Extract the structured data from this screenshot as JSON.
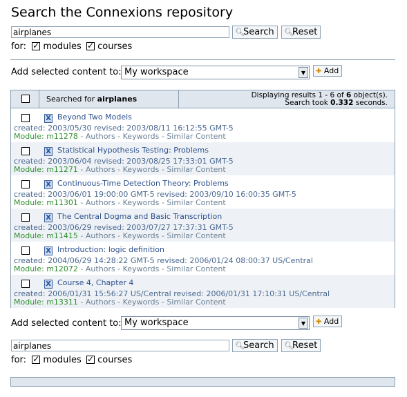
{
  "page_title": "Search the Connexions repository",
  "search_top": {
    "value": "airplanes",
    "search_label": "Search",
    "reset_label": "Reset",
    "for_label": "for:",
    "modules_label": "modules",
    "courses_label": "courses",
    "modules_checked": true,
    "courses_checked": true
  },
  "add_top": {
    "label": "Add selected content to:",
    "selected": "My workspace",
    "button_label": "Add"
  },
  "results": {
    "searched_for_prefix": "Searched for",
    "searched_term": "airplanes",
    "stats_line1_prefix": "Displaying results 1 - 6 of",
    "stats_count": "6",
    "stats_line1_suffix": "object(s).",
    "stats_line2_prefix": "Search took",
    "stats_time": "0.332",
    "stats_line2_suffix": "seconds.",
    "links": {
      "authors": "Authors",
      "keywords": "Keywords",
      "similar": "Similar Content"
    },
    "items": [
      {
        "title": "Beyond Two Models",
        "created": "created: 2003/05/30 revised: 2003/08/11 16:12:55 GMT-5",
        "module_label": "Module:",
        "module_id": "m11278"
      },
      {
        "title": "Statistical Hypothesis Testing: Problems",
        "created": "created: 2003/06/04 revised: 2003/08/25 17:33:01 GMT-5",
        "module_label": "Module:",
        "module_id": "m11271"
      },
      {
        "title": "Continuous-Time Detection Theory: Problems",
        "created": "created: 2003/06/01 19:00:00 GMT-5 revised: 2003/09/10 16:00:35 GMT-5",
        "module_label": "Module:",
        "module_id": "m11301"
      },
      {
        "title": "The Central Dogma and Basic Transcription",
        "created": "created: 2003/06/29 revised: 2003/07/27 17:37:31 GMT-5",
        "module_label": "Module:",
        "module_id": "m11415"
      },
      {
        "title": "Introduction: logic definition",
        "created": "created: 2004/06/29 14:28:22 GMT-5 revised: 2006/01/24 08:00:37 US/Central",
        "module_label": "Module:",
        "module_id": "m12072"
      },
      {
        "title": "Course 4, Chapter 4",
        "created": "created: 2006/01/31 15:56:27 US/Central revised: 2006/01/31 17:10:31 US/Central",
        "module_label": "Module:",
        "module_id": "m13311"
      }
    ]
  },
  "add_bottom": {
    "label": "Add selected content to:",
    "selected": "My workspace",
    "button_label": "Add"
  },
  "search_bottom": {
    "value": "airplanes",
    "search_label": "Search",
    "reset_label": "Reset",
    "for_label": "for:",
    "modules_label": "modules",
    "courses_label": "courses",
    "modules_checked": true,
    "courses_checked": true
  },
  "icons": {
    "search": "magnifier-icon",
    "reset": "reset-icon",
    "add": "add-icon",
    "module": "module-icon",
    "select_arrow": "dropdown-arrow-icon"
  }
}
